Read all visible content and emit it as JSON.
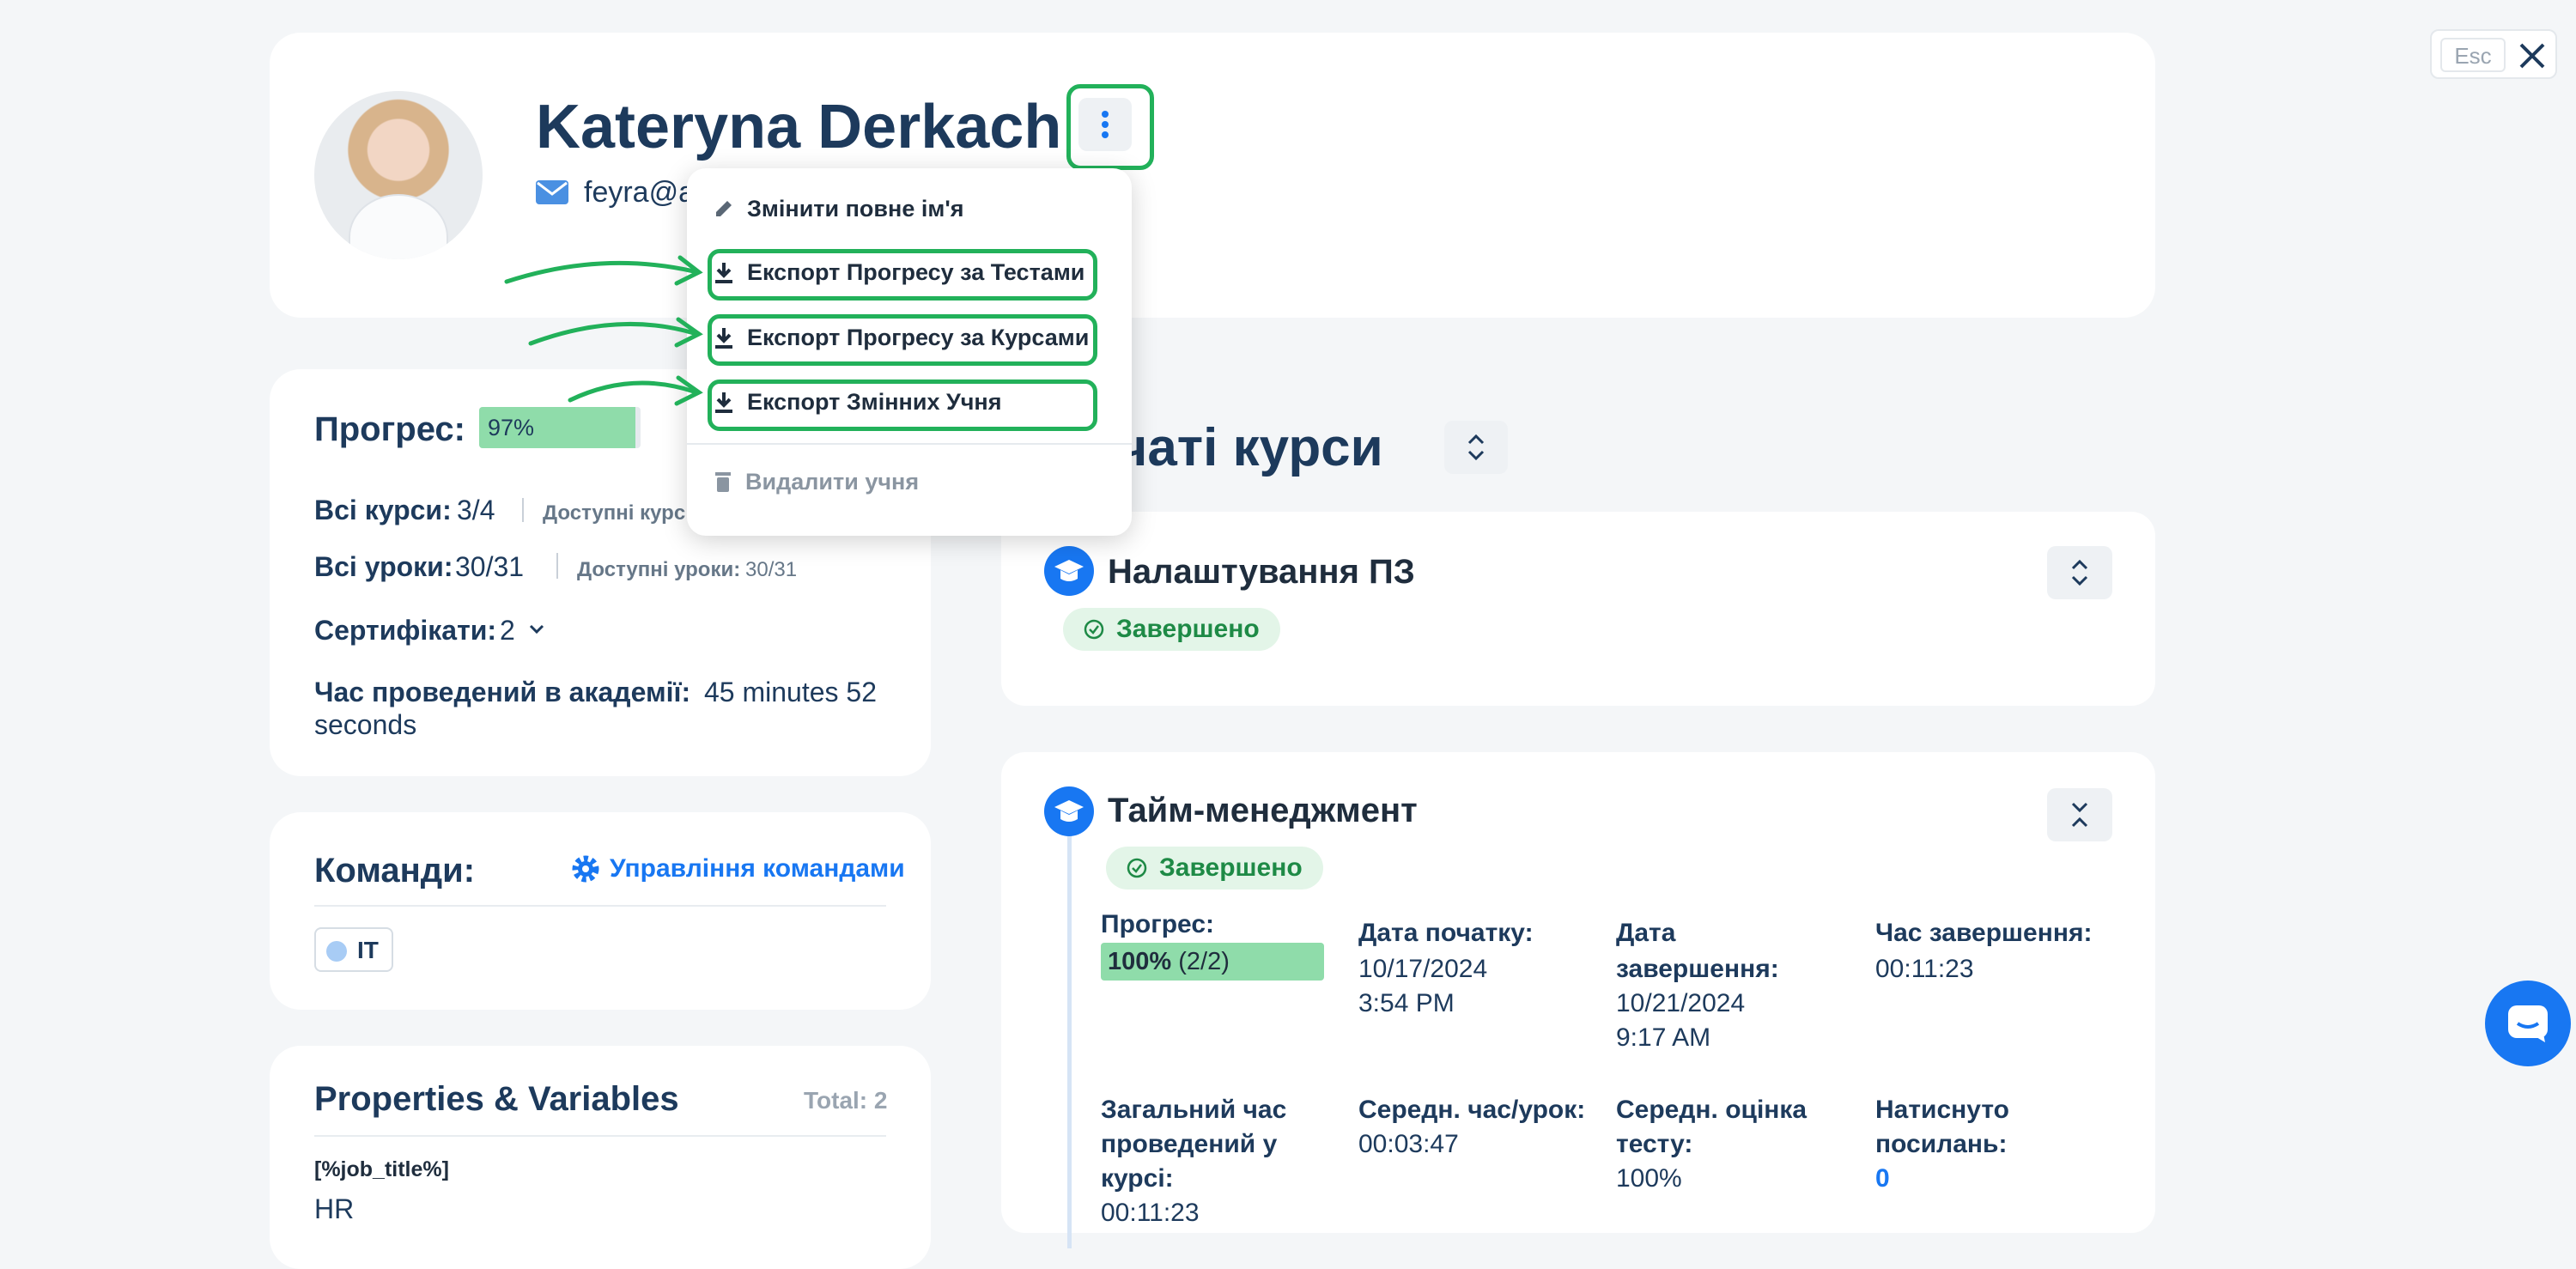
{
  "header": {
    "name": "Kateryna Derkach",
    "email": "feyra@a"
  },
  "menu": {
    "items": [
      {
        "label": "Змінити повне ім'я",
        "icon": "pencil-icon"
      },
      {
        "label": "Експорт Прогресу за Тестами",
        "icon": "download-icon"
      },
      {
        "label": "Експорт Прогресу за Курсами",
        "icon": "download-icon"
      },
      {
        "label": "Експорт Змінних Учня",
        "icon": "download-icon"
      },
      {
        "label": "Видалити учня",
        "icon": "trash-icon"
      }
    ]
  },
  "progress": {
    "title": "Прогрес:",
    "percent_label": "97%",
    "percent": 97,
    "all_courses_label": "Всі курси:",
    "all_courses_value": "3/4",
    "available_courses_label": "Доступні курс",
    "all_lessons_label": "Всі уроки:",
    "all_lessons_value": "30/31",
    "available_lessons_label": "Доступні уроки:",
    "available_lessons_value": "30/31",
    "certificates_label": "Сертифікати:",
    "certificates_value": "2",
    "time_label": "Час проведений в академії:",
    "time_value_1": "45 minutes 52",
    "time_value_2": "seconds"
  },
  "teams": {
    "title": "Команди:",
    "manage_label": "Управління командами",
    "team": "IT"
  },
  "properties": {
    "title": "Properties & Variables",
    "total": "Total: 2",
    "var_name": "[%job_title%]",
    "var_value": "HR"
  },
  "courses": {
    "title": "очаті курси",
    "list": [
      {
        "name": "Налаштування ПЗ",
        "status": "Завершено"
      },
      {
        "name": "Тайм-менеджмент",
        "status": "Завершено"
      }
    ],
    "detail": {
      "progress_label": "Прогрес:",
      "progress_bold": "100%",
      "progress_rest": "(2/2)",
      "progress_value": 100,
      "start_label": "Дата початку:",
      "start_date": "10/17/2024",
      "start_time": "3:54 PM",
      "end_label_1": "Дата",
      "end_label_2": "завершення:",
      "end_date": "10/21/2024",
      "end_time": "9:17 AM",
      "finish_label": "Час завершення:",
      "finish_value": "00:11:23",
      "total_label_1": "Загальний час",
      "total_label_2": "проведений у",
      "total_label_3": "курсі:",
      "total_value": "00:11:23",
      "avg_label": "Середн. час/урок:",
      "avg_value": "00:03:47",
      "score_label_1": "Середн. оцінка",
      "score_label_2": "тесту:",
      "score_value": "100%",
      "clicks_label_1": "Натиснуто",
      "clicks_label_2": "посилань:",
      "clicks_value": "0"
    }
  },
  "esc_label": "Esc",
  "colors": {
    "accent": "#1877f2",
    "green": "#22b15a",
    "text": "#1d3a5c"
  }
}
